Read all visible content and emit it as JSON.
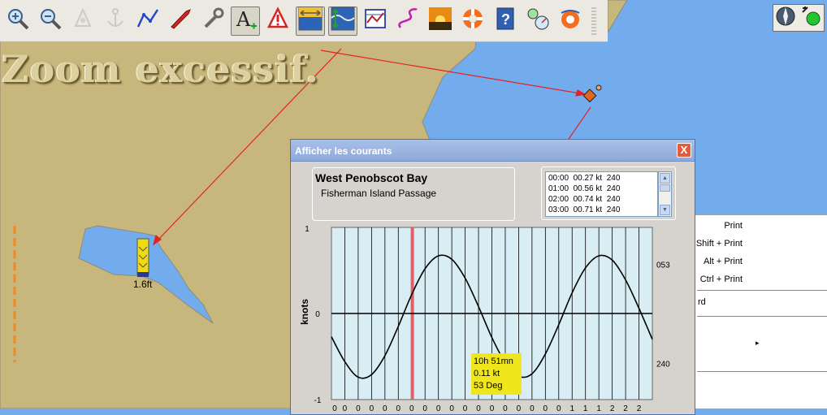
{
  "map": {
    "zoom_message": "Zoom excessif.",
    "tide_marker_label": "1.6ft"
  },
  "toolbar": {
    "buttons": [
      {
        "name": "zoom-in-icon"
      },
      {
        "name": "zoom-out-icon"
      },
      {
        "name": "chart-symbol-icon"
      },
      {
        "name": "anchor-icon"
      },
      {
        "name": "route-icon"
      },
      {
        "name": "boat-icon"
      },
      {
        "name": "wrench-icon"
      },
      {
        "name": "text-icon",
        "pressed": true
      },
      {
        "name": "alert-marker-icon"
      },
      {
        "name": "tide-icon",
        "pressed": true
      },
      {
        "name": "current-icon",
        "pressed": true
      },
      {
        "name": "chart-grid-icon"
      },
      {
        "name": "track-icon"
      },
      {
        "name": "sunset-icon"
      },
      {
        "name": "lifebuoy-icon"
      },
      {
        "name": "help-icon"
      },
      {
        "name": "instruments-icon"
      },
      {
        "name": "mob-icon"
      }
    ]
  },
  "dialog": {
    "title": "Afficher les courants",
    "close_glyph": "X",
    "station_name": "West Penobscot Bay",
    "station_subtitle": "Fisherman Island Passage",
    "table_rows": [
      "00:00  00.27 kt  240",
      "01:00  00.56 kt  240",
      "02:00  00.74 kt  240",
      "03:00  00.71 kt  240"
    ],
    "tooltip": {
      "time": "10h 51mn",
      "speed": "0.11 kt",
      "direction": "53 Deg"
    }
  },
  "context_menu": {
    "items": [
      "Print",
      "Shift + Print",
      "Alt + Print",
      "Ctrl + Print"
    ],
    "partial_item": "rd",
    "submenu_arrow": "▸"
  },
  "chart_data": {
    "type": "line",
    "title": "",
    "xlabel": "",
    "ylabel": "knots",
    "ylim": [
      -1,
      1
    ],
    "xlim": [
      0,
      24
    ],
    "y_tick_labels": [
      "1",
      "0",
      "-1"
    ],
    "right_labels": [
      {
        "text": "053",
        "y": 0.57
      },
      {
        "text": "240",
        "y": -0.58
      }
    ],
    "x_tick_labels": [
      "0",
      "0",
      "0",
      "0",
      "0",
      "0",
      "0",
      "0",
      "0",
      "0",
      "0",
      "0",
      "0",
      "0",
      "0",
      "0",
      "0",
      "0",
      "1",
      "1",
      "1",
      "2",
      "2",
      "2"
    ],
    "current_time_hour": 6.05,
    "series": [
      {
        "x": [
          0,
          1,
          2,
          3,
          4,
          5,
          6,
          7,
          8,
          9,
          10,
          11,
          12,
          13,
          14,
          15,
          16,
          17,
          18,
          19,
          20,
          21,
          22,
          23,
          24
        ],
        "values": [
          -0.27,
          -0.56,
          -0.74,
          -0.71,
          -0.49,
          -0.15,
          0.22,
          0.52,
          0.67,
          0.63,
          0.41,
          0.08,
          -0.28,
          -0.57,
          -0.73,
          -0.7,
          -0.47,
          -0.13,
          0.24,
          0.53,
          0.67,
          0.62,
          0.39,
          0.06,
          -0.3
        ]
      }
    ],
    "grid": true
  },
  "colors": {
    "land": "#c8b77c",
    "water": "#73acec",
    "route_arrows": "#e32222",
    "plot_background": "#d8eef4",
    "current_time_line": "#e0606a",
    "tooltip": "#f0e61c"
  }
}
